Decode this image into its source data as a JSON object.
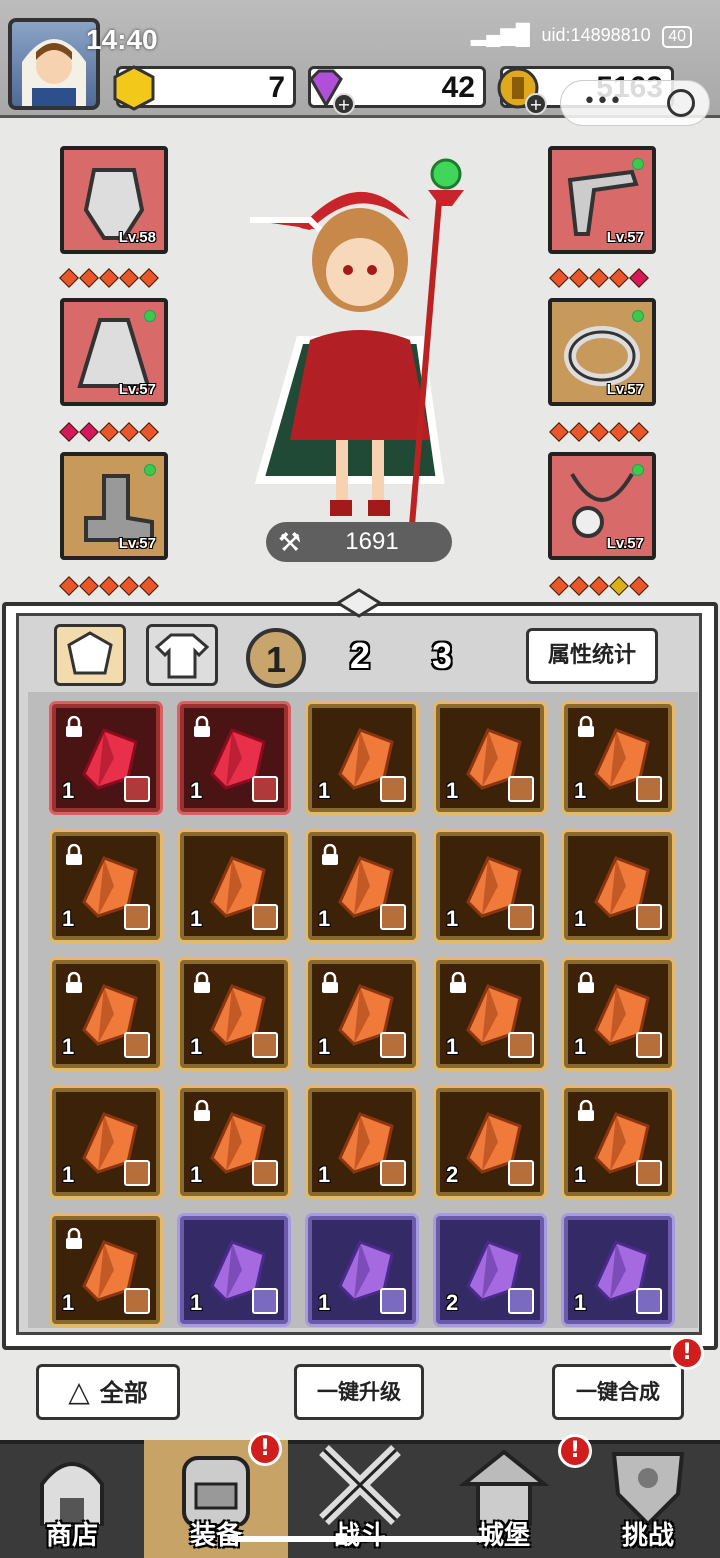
{
  "status_bar": {
    "time": "14:40",
    "uid": "uid:14898810",
    "battery": "40"
  },
  "currencies": [
    {
      "name": "gold-hexagon",
      "value": "7",
      "color": "#f2c81a"
    },
    {
      "name": "purple-diamond",
      "value": "42",
      "color": "#b04fd8"
    },
    {
      "name": "gold-coin",
      "value": "5163",
      "color": "#e0a81c"
    }
  ],
  "equipment": {
    "left": [
      {
        "slot": "helmet",
        "level": "Lv.58",
        "diamonds": [
          "#e8562a",
          "#e8562a",
          "#e8562a",
          "#e8562a",
          "#e8562a"
        ]
      },
      {
        "slot": "cape",
        "level": "Lv.57",
        "diamonds": [
          "#d4185a",
          "#d4185a",
          "#e8562a",
          "#e8562a",
          "#e8562a"
        ]
      },
      {
        "slot": "boots",
        "level": "Lv.57",
        "diamonds": [
          "#e8562a",
          "#e8562a",
          "#e8562a",
          "#e8562a",
          "#e8562a"
        ]
      }
    ],
    "right": [
      {
        "slot": "weapon",
        "level": "Lv.57",
        "diamonds": [
          "#e8562a",
          "#e8562a",
          "#e8562a",
          "#e8562a",
          "#d4185a"
        ]
      },
      {
        "slot": "ring",
        "level": "Lv.57",
        "diamonds": [
          "#e8562a",
          "#e8562a",
          "#e8562a",
          "#e8562a",
          "#e8562a"
        ]
      },
      {
        "slot": "necklace",
        "level": "Lv.57",
        "diamonds": [
          "#e8562a",
          "#e8562a",
          "#e8562a",
          "#d8b018",
          "#e8562a"
        ]
      }
    ]
  },
  "power": "1691",
  "panel": {
    "tabs": [
      "1",
      "2",
      "3"
    ],
    "stats_button": "属性统计"
  },
  "gems": [
    {
      "color": "red",
      "count": "1",
      "locked": true,
      "badge": "weapon"
    },
    {
      "color": "red",
      "count": "1",
      "locked": true,
      "badge": "weapon"
    },
    {
      "color": "orange",
      "count": "1",
      "locked": false,
      "badge": "ring"
    },
    {
      "color": "orange",
      "count": "1",
      "locked": false,
      "badge": "ring"
    },
    {
      "color": "orange",
      "count": "1",
      "locked": true,
      "badge": "cape"
    },
    {
      "color": "orange",
      "count": "1",
      "locked": true,
      "badge": "cape"
    },
    {
      "color": "orange",
      "count": "1",
      "locked": false,
      "badge": "cape"
    },
    {
      "color": "orange",
      "count": "1",
      "locked": true,
      "badge": "boots"
    },
    {
      "color": "orange",
      "count": "1",
      "locked": false,
      "badge": "boots"
    },
    {
      "color": "orange",
      "count": "1",
      "locked": false,
      "badge": "weapon"
    },
    {
      "color": "orange",
      "count": "1",
      "locked": true,
      "badge": "weapon"
    },
    {
      "color": "orange",
      "count": "1",
      "locked": true,
      "badge": "weapon"
    },
    {
      "color": "orange",
      "count": "1",
      "locked": true,
      "badge": "weapon"
    },
    {
      "color": "orange",
      "count": "1",
      "locked": true,
      "badge": "helmet"
    },
    {
      "color": "orange",
      "count": "1",
      "locked": true,
      "badge": "helmet"
    },
    {
      "color": "orange",
      "count": "1",
      "locked": false,
      "badge": "helmet"
    },
    {
      "color": "orange",
      "count": "1",
      "locked": true,
      "badge": "helmet"
    },
    {
      "color": "orange",
      "count": "1",
      "locked": false,
      "badge": "necklace"
    },
    {
      "color": "orange",
      "count": "2",
      "locked": false,
      "badge": "necklace"
    },
    {
      "color": "orange",
      "count": "1",
      "locked": true,
      "badge": "necklace"
    },
    {
      "color": "orange",
      "count": "1",
      "locked": true,
      "badge": "necklace"
    },
    {
      "color": "purple",
      "count": "1",
      "locked": false,
      "badge": "cape"
    },
    {
      "color": "purple",
      "count": "1",
      "locked": false,
      "badge": "cape"
    },
    {
      "color": "purple",
      "count": "2",
      "locked": false,
      "badge": "cape"
    },
    {
      "color": "purple",
      "count": "1",
      "locked": false,
      "badge": "boots"
    }
  ],
  "actions": {
    "filter": "全部",
    "upgrade_all": "一键升级",
    "merge_all": "一键合成",
    "merge_alert": "!"
  },
  "nav": [
    {
      "label": "商店",
      "icon": "shop-icon",
      "active": false,
      "alert": ""
    },
    {
      "label": "装备",
      "icon": "backpack-icon",
      "active": true,
      "alert": "!"
    },
    {
      "label": "战斗",
      "icon": "crossed-swords-icon",
      "active": false,
      "alert": ""
    },
    {
      "label": "城堡",
      "icon": "castle-icon",
      "active": false,
      "alert": "!"
    },
    {
      "label": "挑战",
      "icon": "shield-icon",
      "active": false,
      "alert": ""
    }
  ]
}
